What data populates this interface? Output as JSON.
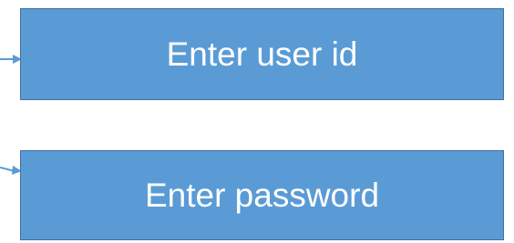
{
  "flowchart": {
    "steps": [
      {
        "label": "Enter user id"
      },
      {
        "label": "Enter password"
      }
    ]
  },
  "colors": {
    "box_fill": "#5b9bd5",
    "box_border": "#41719c",
    "text": "#ffffff",
    "arrow": "#5b9bd5"
  }
}
